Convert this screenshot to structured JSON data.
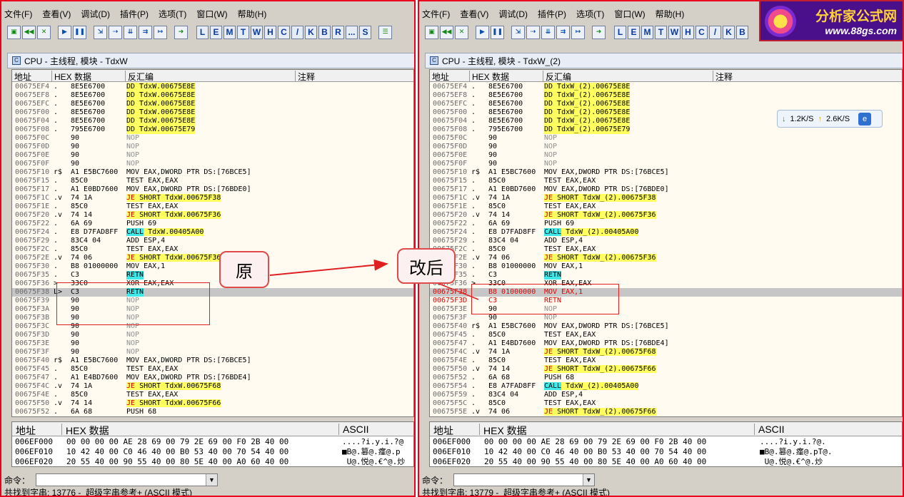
{
  "menu": [
    "文件(F)",
    "查看(V)",
    "调试(D)",
    "插件(P)",
    "选项(T)",
    "窗口(W)",
    "帮助(H)"
  ],
  "toolbar_letters": [
    "L",
    "E",
    "M",
    "T",
    "W",
    "H",
    "C",
    "/",
    "K",
    "B",
    "R",
    "...",
    "S"
  ],
  "left": {
    "title": "CPU - 主线程, 模块 - TdxW",
    "columns": {
      "addr": "地址",
      "hex": "HEX 数据",
      "disasm": "反汇编",
      "comment": "注释"
    },
    "rows": [
      {
        "a": "00675EF4",
        "m": ".",
        "h": "8E5E6700",
        "d": "DD TdxW.00675E8E",
        "s": "y"
      },
      {
        "a": "00675EF8",
        "m": ".",
        "h": "8E5E6700",
        "d": "DD TdxW.00675E8E",
        "s": "y"
      },
      {
        "a": "00675EFC",
        "m": ".",
        "h": "8E5E6700",
        "d": "DD TdxW.00675E8E",
        "s": "y"
      },
      {
        "a": "00675F00",
        "m": ".",
        "h": "8E5E6700",
        "d": "DD TdxW.00675E8E",
        "s": "y"
      },
      {
        "a": "00675F04",
        "m": ".",
        "h": "8E5E6700",
        "d": "DD TdxW.00675E8E",
        "s": "y"
      },
      {
        "a": "00675F08",
        "m": ".",
        "h": "795E6700",
        "d": "DD TdxW.00675E79",
        "s": "y"
      },
      {
        "a": "00675F0C",
        "m": "",
        "h": "90",
        "d": "NOP",
        "s": "g"
      },
      {
        "a": "00675F0D",
        "m": "",
        "h": "90",
        "d": "NOP",
        "s": "g"
      },
      {
        "a": "00675F0E",
        "m": "",
        "h": "90",
        "d": "NOP",
        "s": "g"
      },
      {
        "a": "00675F0F",
        "m": "",
        "h": "90",
        "d": "NOP",
        "s": "g"
      },
      {
        "a": "00675F10",
        "m": "r$",
        "h": "A1 E5BC7600",
        "d": "MOV EAX,DWORD PTR DS:[76BCE5]",
        "s": ""
      },
      {
        "a": "00675F15",
        "m": ".",
        "h": "85C0",
        "d": "TEST EAX,EAX",
        "s": ""
      },
      {
        "a": "00675F17",
        "m": ".",
        "h": "A1 E0BD7600",
        "d": "MOV EAX,DWORD PTR DS:[76BDE0]",
        "s": ""
      },
      {
        "a": "00675F1C",
        "m": ".v",
        "h": "74 1A",
        "d": "JE SHORT TdxW.00675F38",
        "s": "j"
      },
      {
        "a": "00675F1E",
        "m": ".",
        "h": "85C0",
        "d": "TEST EAX,EAX",
        "s": ""
      },
      {
        "a": "00675F20",
        "m": ".v",
        "h": "74 14",
        "d": "JE SHORT TdxW.00675F36",
        "s": "j"
      },
      {
        "a": "00675F22",
        "m": ".",
        "h": "6A 69",
        "d": "PUSH 69",
        "s": ""
      },
      {
        "a": "00675F24",
        "m": ".",
        "h": "E8 D7FAD8FF",
        "d": "CALL TdxW.00405A00",
        "s": "c"
      },
      {
        "a": "00675F29",
        "m": ".",
        "h": "83C4 04",
        "d": "ADD ESP,4",
        "s": ""
      },
      {
        "a": "00675F2C",
        "m": ".",
        "h": "85C0",
        "d": "TEST EAX,EAX",
        "s": ""
      },
      {
        "a": "00675F2E",
        "m": ".v",
        "h": "74 06",
        "d": "JE SHORT TdxW.00675F36",
        "s": "j"
      },
      {
        "a": "00675F30",
        "m": ".",
        "h": "B8 01000000",
        "d": "MOV EAX,1",
        "s": ""
      },
      {
        "a": "00675F35",
        "m": ".",
        "h": "C3",
        "d": "RETN",
        "s": "c"
      },
      {
        "a": "00675F36",
        "m": ">",
        "h": "33C0",
        "d": "XOR EAX,EAX",
        "s": ""
      },
      {
        "a": "00675F38",
        "m": "L>",
        "h": "C3",
        "d": "RETN",
        "s": "sel"
      },
      {
        "a": "00675F39",
        "m": "",
        "h": "90",
        "d": "NOP",
        "s": "g"
      },
      {
        "a": "00675F3A",
        "m": "",
        "h": "90",
        "d": "NOP",
        "s": "g"
      },
      {
        "a": "00675F3B",
        "m": "",
        "h": "90",
        "d": "NOP",
        "s": "g"
      },
      {
        "a": "00675F3C",
        "m": "",
        "h": "90",
        "d": "NOP",
        "s": "g"
      },
      {
        "a": "00675F3D",
        "m": "",
        "h": "90",
        "d": "NOP",
        "s": "g"
      },
      {
        "a": "00675F3E",
        "m": "",
        "h": "90",
        "d": "NOP",
        "s": "g"
      },
      {
        "a": "00675F3F",
        "m": "",
        "h": "90",
        "d": "NOP",
        "s": "g"
      },
      {
        "a": "00675F40",
        "m": "r$",
        "h": "A1 E5BC7600",
        "d": "MOV EAX,DWORD PTR DS:[76BCE5]",
        "s": ""
      },
      {
        "a": "00675F45",
        "m": ".",
        "h": "85C0",
        "d": "TEST EAX,EAX",
        "s": ""
      },
      {
        "a": "00675F47",
        "m": ".",
        "h": "A1 E4BD7600",
        "d": "MOV EAX,DWORD PTR DS:[76BDE4]",
        "s": ""
      },
      {
        "a": "00675F4C",
        "m": ".v",
        "h": "74 1A",
        "d": "JE SHORT TdxW.00675F68",
        "s": "j"
      },
      {
        "a": "00675F4E",
        "m": ".",
        "h": "85C0",
        "d": "TEST EAX,EAX",
        "s": ""
      },
      {
        "a": "00675F50",
        "m": ".v",
        "h": "74 14",
        "d": "JE SHORT TdxW.00675F66",
        "s": "j"
      },
      {
        "a": "00675F52",
        "m": ".",
        "h": "6A 68",
        "d": "PUSH 68",
        "s": ""
      }
    ],
    "hex_header": {
      "addr": "地址",
      "hex": "HEX 数据",
      "ascii": "ASCII"
    },
    "hex_rows": [
      {
        "a": "006EF000",
        "h": "00 00 00 00 AE 28 69 00 79 2E 69 00 F0 2B 40 00",
        "t": "....?i.y.i.?@"
      },
      {
        "a": "006EF010",
        "h": "10 42 40 00 C0 46 40 00 B0 53 40 00 70 54 40 00",
        "t": "■B@.篡@.瘽@.p"
      },
      {
        "a": "006EF020",
        "h": "20 55 40 00 90 55 40 00 80 5E 40 00 A0 60 40 00",
        "t": " U@.悦@.€^@.炒"
      }
    ],
    "cmd_label": "命令：",
    "status": "共找到字串: 13776 -  超级字串参考+ (ASCII 模式)"
  },
  "right": {
    "title": "CPU - 主线程, 模块 - TdxW_(2)",
    "columns": {
      "addr": "地址",
      "hex": "HEX 数据",
      "disasm": "反汇编",
      "comment": "注释"
    },
    "rows": [
      {
        "a": "00675EF4",
        "m": ".",
        "h": "8E5E6700",
        "d": "DD TdxW_(2).00675E8E",
        "s": "y"
      },
      {
        "a": "00675EF8",
        "m": ".",
        "h": "8E5E6700",
        "d": "DD TdxW_(2).00675E8E",
        "s": "y"
      },
      {
        "a": "00675EFC",
        "m": ".",
        "h": "8E5E6700",
        "d": "DD TdxW_(2).00675E8E",
        "s": "y"
      },
      {
        "a": "00675F00",
        "m": ".",
        "h": "8E5E6700",
        "d": "DD TdxW_(2).00675E8E",
        "s": "y"
      },
      {
        "a": "00675F04",
        "m": ".",
        "h": "8E5E6700",
        "d": "DD TdxW_(2).00675E8E",
        "s": "y"
      },
      {
        "a": "00675F08",
        "m": ".",
        "h": "795E6700",
        "d": "DD TdxW_(2).00675E79",
        "s": "y"
      },
      {
        "a": "00675F0C",
        "m": "",
        "h": "90",
        "d": "NOP",
        "s": "g"
      },
      {
        "a": "00675F0D",
        "m": "",
        "h": "90",
        "d": "NOP",
        "s": "g"
      },
      {
        "a": "00675F0E",
        "m": "",
        "h": "90",
        "d": "NOP",
        "s": "g"
      },
      {
        "a": "00675F0F",
        "m": "",
        "h": "90",
        "d": "NOP",
        "s": "g"
      },
      {
        "a": "00675F10",
        "m": "r$",
        "h": "A1 E5BC7600",
        "d": "MOV EAX,DWORD PTR DS:[76BCE5]",
        "s": ""
      },
      {
        "a": "00675F15",
        "m": ".",
        "h": "85C0",
        "d": "TEST EAX,EAX",
        "s": ""
      },
      {
        "a": "00675F17",
        "m": ".",
        "h": "A1 E0BD7600",
        "d": "MOV EAX,DWORD PTR DS:[76BDE0]",
        "s": ""
      },
      {
        "a": "00675F1C",
        "m": ".v",
        "h": "74 1A",
        "d": "JE SHORT TdxW_(2).00675F38",
        "s": "j"
      },
      {
        "a": "00675F1E",
        "m": ".",
        "h": "85C0",
        "d": "TEST EAX,EAX",
        "s": ""
      },
      {
        "a": "00675F20",
        "m": ".v",
        "h": "74 14",
        "d": "JE SHORT TdxW_(2).00675F36",
        "s": "j"
      },
      {
        "a": "00675F22",
        "m": ".",
        "h": "6A 69",
        "d": "PUSH 69",
        "s": ""
      },
      {
        "a": "00675F24",
        "m": ".",
        "h": "E8 D7FAD8FF",
        "d": "CALL TdxW_(2).00405A00",
        "s": "c"
      },
      {
        "a": "00675F29",
        "m": ".",
        "h": "83C4 04",
        "d": "ADD ESP,4",
        "s": ""
      },
      {
        "a": "00675F2C",
        "m": ".",
        "h": "85C0",
        "d": "TEST EAX,EAX",
        "s": ""
      },
      {
        "a": "00675F2E",
        "m": ".v",
        "h": "74 06",
        "d": "JE SHORT TdxW_(2).00675F36",
        "s": "j"
      },
      {
        "a": "00675F30",
        "m": ".",
        "h": "B8 01000000",
        "d": "MOV EAX,1",
        "s": ""
      },
      {
        "a": "00675F35",
        "m": ".",
        "h": "C3",
        "d": "RETN",
        "s": "c"
      },
      {
        "a": "00675F36",
        "m": ">",
        "h": "33C0",
        "d": "XOR EAX,EAX",
        "s": ""
      },
      {
        "a": "00675F38",
        "m": "",
        "h": "B8 01000000",
        "d": "MOV EAX,1",
        "s": "selred"
      },
      {
        "a": "00675F3D",
        "m": "",
        "h": "C3",
        "d": "RETN",
        "s": "red"
      },
      {
        "a": "00675F3E",
        "m": "",
        "h": "90",
        "d": "NOP",
        "s": "g"
      },
      {
        "a": "00675F3F",
        "m": "",
        "h": "90",
        "d": "NOP",
        "s": "g"
      },
      {
        "a": "00675F40",
        "m": "r$",
        "h": "A1 E5BC7600",
        "d": "MOV EAX,DWORD PTR DS:[76BCE5]",
        "s": ""
      },
      {
        "a": "00675F45",
        "m": ".",
        "h": "85C0",
        "d": "TEST EAX,EAX",
        "s": ""
      },
      {
        "a": "00675F47",
        "m": ".",
        "h": "A1 E4BD7600",
        "d": "MOV EAX,DWORD PTR DS:[76BDE4]",
        "s": ""
      },
      {
        "a": "00675F4C",
        "m": ".v",
        "h": "74 1A",
        "d": "JE SHORT TdxW_(2).00675F68",
        "s": "j"
      },
      {
        "a": "00675F4E",
        "m": ".",
        "h": "85C0",
        "d": "TEST EAX,EAX",
        "s": ""
      },
      {
        "a": "00675F50",
        "m": ".v",
        "h": "74 14",
        "d": "JE SHORT TdxW_(2).00675F66",
        "s": "j"
      },
      {
        "a": "00675F52",
        "m": ".",
        "h": "6A 68",
        "d": "PUSH 68",
        "s": ""
      },
      {
        "a": "00675F54",
        "m": ".",
        "h": "E8 A7FAD8FF",
        "d": "CALL TdxW_(2).00405A00",
        "s": "c"
      },
      {
        "a": "00675F59",
        "m": ".",
        "h": "83C4 04",
        "d": "ADD ESP,4",
        "s": ""
      },
      {
        "a": "00675F5C",
        "m": ".",
        "h": "85C0",
        "d": "TEST EAX,EAX",
        "s": ""
      },
      {
        "a": "00675F5E",
        "m": ".v",
        "h": "74 06",
        "d": "JE SHORT TdxW_(2).00675F66",
        "s": "j"
      }
    ],
    "hex_header": {
      "addr": "地址",
      "hex": "HEX 数据",
      "ascii": "ASCII"
    },
    "hex_rows": [
      {
        "a": "006EF000",
        "h": "00 00 00 00 AE 28 69 00 79 2E 69 00 F0 2B 40 00",
        "t": "....?i.y.i.?@."
      },
      {
        "a": "006EF010",
        "h": "10 42 40 00 C0 46 40 00 B0 53 40 00 70 54 40 00",
        "t": "■B@.篡@.瘽@.pT@."
      },
      {
        "a": "006EF020",
        "h": "20 55 40 00 90 55 40 00 80 5E 40 00 A0 60 40 00",
        "t": " U@.悦@.€^@.炒"
      }
    ],
    "cmd_label": "命令：",
    "status": "共找到字串: 13779 -  超级字串参考+ (ASCII 模式)"
  },
  "annotations": {
    "original": "原",
    "modified": "改后"
  },
  "net_widget": {
    "down": "1.2K/S",
    "up": "2.6K/S"
  },
  "logo": {
    "title": "分析家公式网",
    "url": "www.88gs.com"
  },
  "colors": {
    "highlight_yellow": "#ffff60",
    "highlight_cyan": "#40e8e8",
    "annotation_red": "#e02020"
  }
}
